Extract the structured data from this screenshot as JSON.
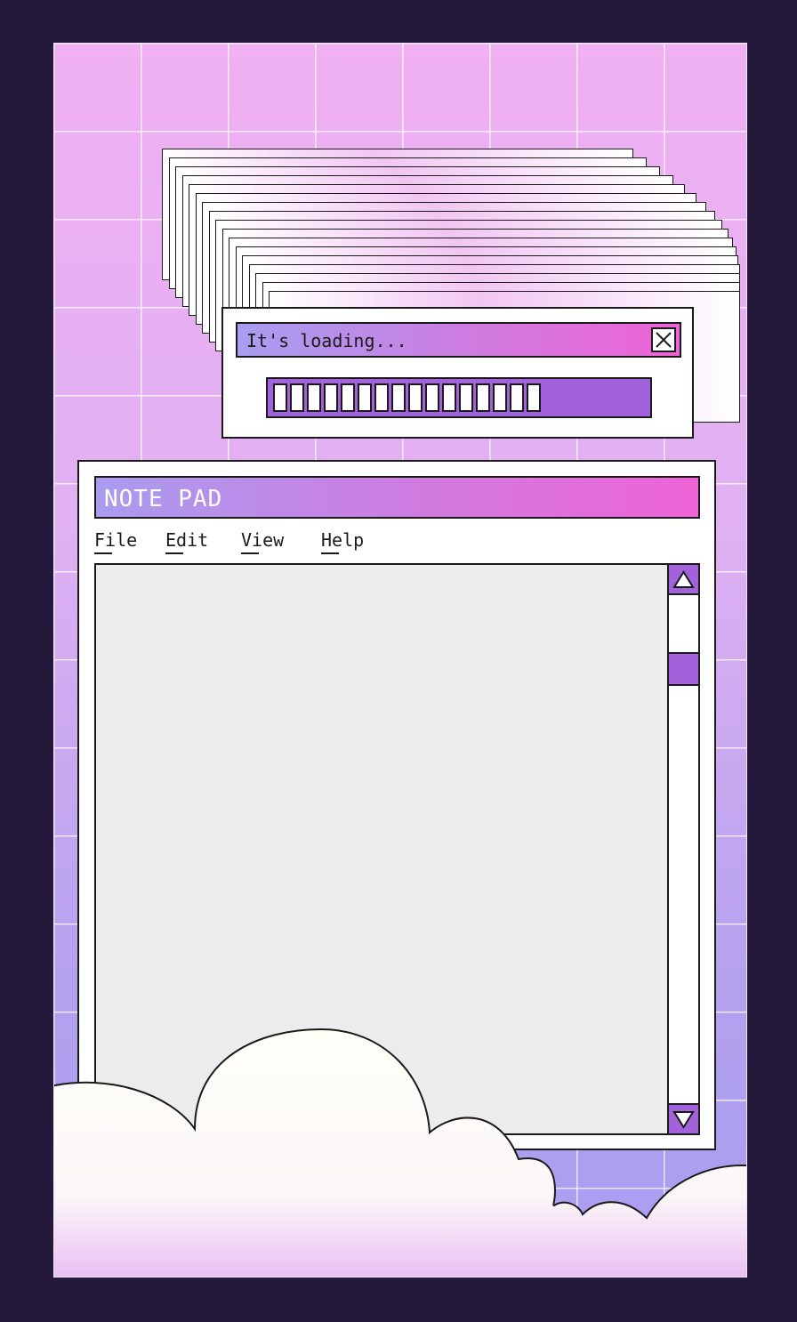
{
  "colors": {
    "page_background": "#24193a",
    "accent_purple": "#a262dc",
    "title_gradient_start": "#a99cf0",
    "title_gradient_end": "#ef63d6",
    "text_area": "#ececec",
    "cloud": "#fffff8"
  },
  "loading_dialog": {
    "title": "It's loading...",
    "close_icon": "close-icon",
    "progress_segments_filled": 16
  },
  "notepad": {
    "title": "NOTE PAD",
    "menu": [
      "File",
      "Edit",
      "View",
      "Help"
    ],
    "text_content": "",
    "scroll_up_icon": "triangle-up-icon",
    "scroll_down_icon": "triangle-down-icon"
  }
}
